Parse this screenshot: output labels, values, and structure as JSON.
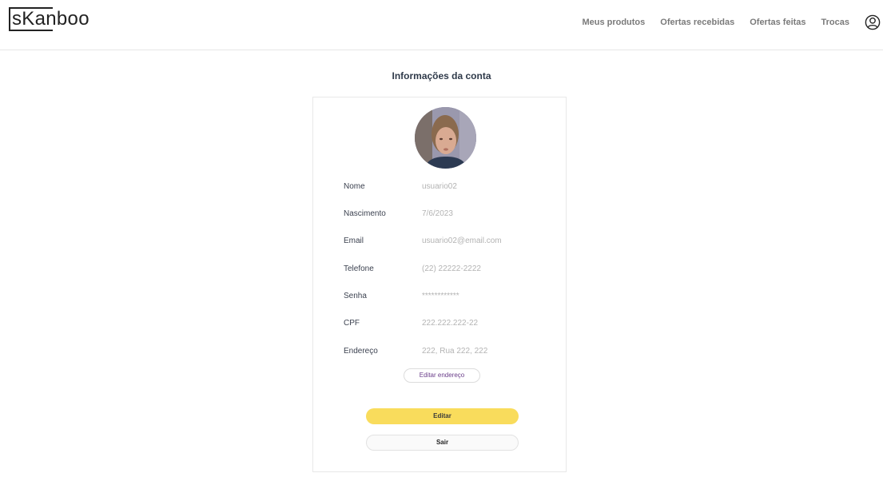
{
  "header": {
    "logo": "sKanboo",
    "nav": [
      "Meus produtos",
      "Ofertas recebidas",
      "Ofertas feitas",
      "Trocas"
    ]
  },
  "page": {
    "title": "Informações da conta"
  },
  "account": {
    "fields": [
      {
        "label": "Nome",
        "value": "usuario02"
      },
      {
        "label": "Nascimento",
        "value": "7/6/2023"
      },
      {
        "label": "Email",
        "value": "usuario02@email.com"
      },
      {
        "label": "Telefone",
        "value": "(22) 22222-2222"
      },
      {
        "label": "Senha",
        "value": "************"
      },
      {
        "label": "CPF",
        "value": "222.222.222-22"
      },
      {
        "label": "Endereço",
        "value": "222, Rua 222, 222"
      }
    ],
    "edit_address_label": "Editar endereço",
    "edit_label": "Editar",
    "logout_label": "Sair"
  },
  "colors": {
    "primary_button": "#f9dc5c",
    "edit_address_text": "#6a3d8a"
  }
}
